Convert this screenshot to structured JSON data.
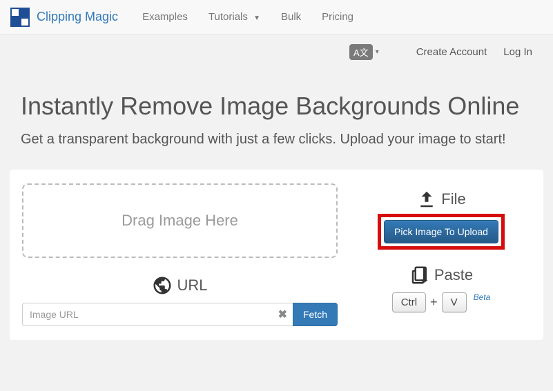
{
  "brand": "Clipping Magic",
  "nav": {
    "examples": "Examples",
    "tutorials": "Tutorials",
    "bulk": "Bulk",
    "pricing": "Pricing"
  },
  "lang_icon": "A文",
  "auth": {
    "create": "Create Account",
    "login": "Log In"
  },
  "hero": {
    "title": "Instantly Remove Image Backgrounds Online",
    "subtitle": "Get a transparent background with just a few clicks. Upload your image to start!"
  },
  "upload": {
    "drag": "Drag Image Here",
    "url_label": "URL",
    "url_placeholder": "Image URL",
    "fetch": "Fetch",
    "file_label": "File",
    "pick_button": "Pick Image To Upload",
    "paste_label": "Paste",
    "key1": "Ctrl",
    "key_plus": "+",
    "key2": "V",
    "beta": "Beta"
  }
}
